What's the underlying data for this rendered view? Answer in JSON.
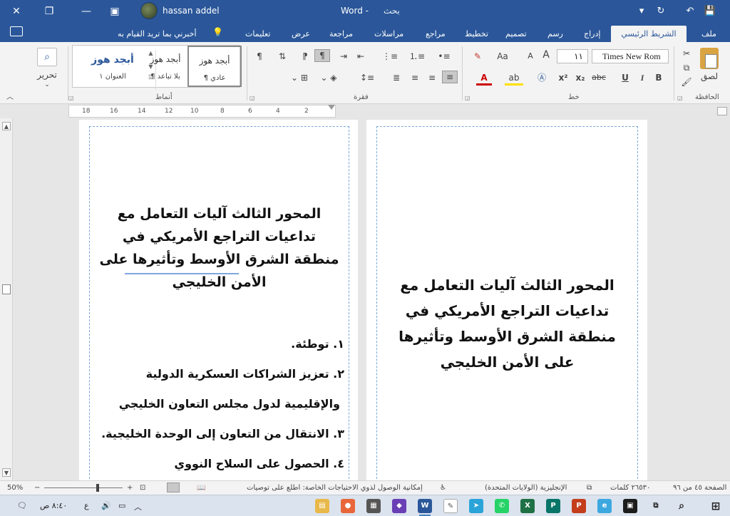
{
  "titlebar": {
    "user_name": "hassan addel",
    "doc_title": "Word  -",
    "search_label": "بحث",
    "close_icon": "close-icon",
    "restore_icon": "restore-icon",
    "minimize_icon": "minimize-icon",
    "ribbon_display_icon": "ribbon-display-icon"
  },
  "tabs": {
    "file": "ملف",
    "home": "الشريط الرئيسي",
    "insert": "إدراج",
    "draw": "رسم",
    "design": "تصميم",
    "layout": "تخطيط",
    "references": "مراجع",
    "mailings": "مراسلات",
    "review": "مراجعة",
    "view": "عرض",
    "help": "تعليمات",
    "tell_me": "أخبرني بما تريد القيام به"
  },
  "ribbon": {
    "clipboard": {
      "label": "الحافظة",
      "paste": "لصق"
    },
    "font": {
      "label": "خط",
      "font_name": "Times New Rom",
      "font_size": "١١",
      "bold": "B",
      "italic": "I",
      "underline": "U",
      "strike": "abc",
      "subscript": "x₂",
      "superscript": "x²",
      "grow": "A",
      "shrink": "A",
      "change_case": "Aa",
      "font_color": "A",
      "highlight": "ab"
    },
    "paragraph": {
      "label": "فقرة",
      "pilcrow": "¶"
    },
    "styles": {
      "label": "أنماط",
      "items": [
        {
          "sample": "أبجد هوز",
          "name": "¶ عادي"
        },
        {
          "sample": "أبجد هوز",
          "name": "¶ بلا تباعد"
        },
        {
          "sample": "أبجد هوز",
          "name": "العنوان ١"
        }
      ]
    },
    "editing": {
      "label": "تحرير"
    }
  },
  "ruler": {
    "ticks": [
      "2",
      "4",
      "6",
      "8",
      "10",
      "12",
      "14",
      "16",
      "18"
    ]
  },
  "pages": {
    "right": {
      "heading_lines": [
        "المحور الثالث آليات التعامل مع",
        "تداعيات التراجع الأمريكي في",
        "منطقة الشرق الأوسط وتأثيرها",
        "على الأمن الخليجي"
      ]
    },
    "left": {
      "heading_lines": [
        "المحور الثالث آليات التعامل مع",
        "تداعيات التراجع الأمريكي في",
        "منطقة الشرق الأوسط وتأثيرها على",
        "الأمن الخليجي"
      ],
      "list_lines": [
        "١. توطئة.",
        "٢. تعزيز الشراكات العسكرية الدولية",
        "والإقليمية لدول مجلس التعاون الخليجي",
        "٣. الانتقال من التعاون إلى الوحدة الخليجية.",
        "٤. الحصول على السلاح النووي"
      ]
    }
  },
  "statusbar": {
    "page_info": "الصفحة ٤٥ من ٩٦",
    "word_count": "٢٦٥٣٠ كلمات",
    "language": "الإنجليزية (الولايات المتحدة)",
    "accessibility": "إمكانية الوصول لذوي الاحتياجات الخاصة: اطلع على توصيات",
    "zoom": "50%",
    "zoom_minus": "−",
    "zoom_plus": "+"
  },
  "taskbar": {
    "time": "٨:٤٠ ص",
    "lang": "ع"
  }
}
